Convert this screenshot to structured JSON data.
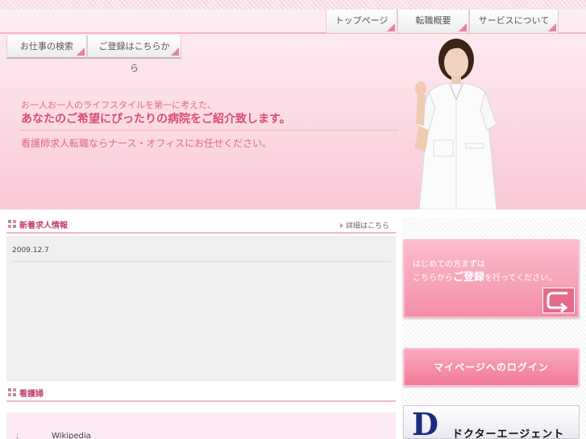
{
  "nav_top": [
    {
      "label": "トップページ"
    },
    {
      "label": "転職概要"
    },
    {
      "label": "サービスについて"
    }
  ],
  "nav_left": [
    {
      "label": "お仕事の検索"
    },
    {
      "label": "ご登録はこちらから"
    }
  ],
  "hero": {
    "line1": "お一人お一人のライフスタイルを第一に考えた、",
    "line2": "あなたのご希望にぴったりの病院をご紹介致します。",
    "line3": "看護師求人転職ならナース・オフィスにお任せください。"
  },
  "news": {
    "title": "新着求人情報",
    "more": "詳細はこちら",
    "date": "2009.12.7"
  },
  "nurse_section": {
    "title": "看護婦",
    "colon": ":",
    "source": "Wikipedia"
  },
  "sidebar": {
    "first_time_line1": "はじめての方まずは",
    "first_time_line2_pre": "こちらから",
    "first_time_line2_bold": "ご登録",
    "first_time_line2_post": "を行ってください。",
    "login_label": "マイページへのログイン",
    "agent_letter": "D",
    "agent_label": "ドクターエージェント"
  },
  "colors": {
    "accent": "#e8819b",
    "header_pink": "#f9c8d6",
    "title_red": "#c24466"
  }
}
